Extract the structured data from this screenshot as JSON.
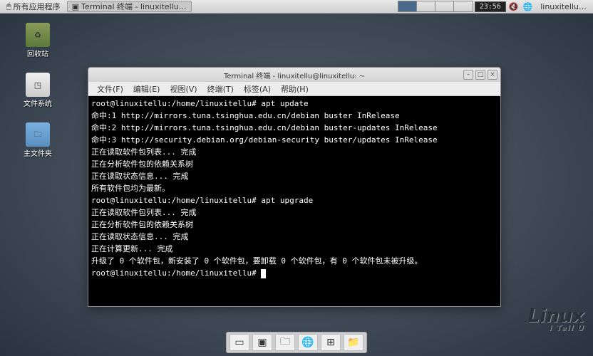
{
  "taskbar": {
    "apps_menu": "所有应用程序",
    "active_task": "Terminal 终端 - linuxitellu…",
    "clock": "23:56",
    "username": "linuxitellu…"
  },
  "desktop_icons": {
    "recycle": "回收站",
    "filesystem": "文件系统",
    "home": "主文件夹"
  },
  "window": {
    "title": "Terminal 终端 - linuxitellu@linuxitellu: ~",
    "menus": {
      "file": "文件(F)",
      "edit": "编辑(E)",
      "view": "视图(V)",
      "terminal": "终端(T)",
      "tabs": "标签(A)",
      "help": "帮助(H)"
    }
  },
  "terminal": {
    "lines": [
      "root@linuxitellu:/home/linuxitellu# apt update",
      "命中:1 http://mirrors.tuna.tsinghua.edu.cn/debian buster InRelease",
      "命中:2 http://mirrors.tuna.tsinghua.edu.cn/debian buster-updates InRelease",
      "命中:3 http://security.debian.org/debian-security buster/updates InRelease",
      "正在读取软件包列表... 完成",
      "正在分析软件包的依赖关系树",
      "正在读取状态信息... 完成",
      "所有软件包均为最新。",
      "root@linuxitellu:/home/linuxitellu# apt upgrade",
      "正在读取软件包列表... 完成",
      "正在分析软件包的依赖关系树",
      "正在读取状态信息... 完成",
      "正在计算更新... 完成",
      "升级了 0 个软件包，新安装了 0 个软件包，要卸载 0 个软件包，有 0 个软件包未被升级。",
      "root@linuxitellu:/home/linuxitellu# "
    ]
  },
  "watermark": {
    "main": "Linux",
    "sub": "I Tell U"
  }
}
